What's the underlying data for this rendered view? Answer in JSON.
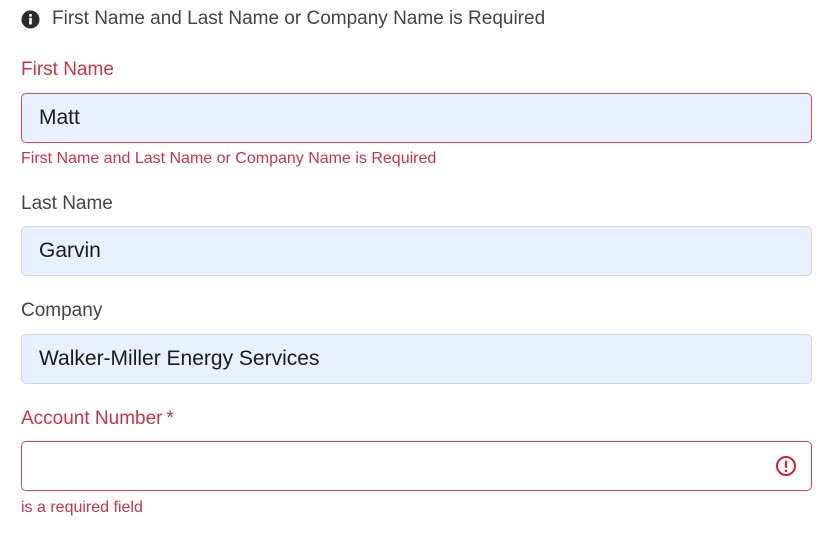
{
  "notice": {
    "icon": "info-circle-icon",
    "text": "First Name and Last Name or Company Name is Required"
  },
  "form": {
    "first_name": {
      "label": "First Name",
      "value": "Matt",
      "error": "First Name and Last Name or Company Name is Required"
    },
    "last_name": {
      "label": "Last Name",
      "value": "Garvin"
    },
    "company": {
      "label": "Company",
      "value": "Walker-Miller Energy Services"
    },
    "account_number": {
      "label": "Account Number",
      "required_marker": "*",
      "value": "",
      "icon": "error-circle-icon",
      "error": "is a required field"
    }
  },
  "colors": {
    "error": "#cc3344",
    "autofill_bg": "#e8f0fe",
    "text": "#444444"
  }
}
